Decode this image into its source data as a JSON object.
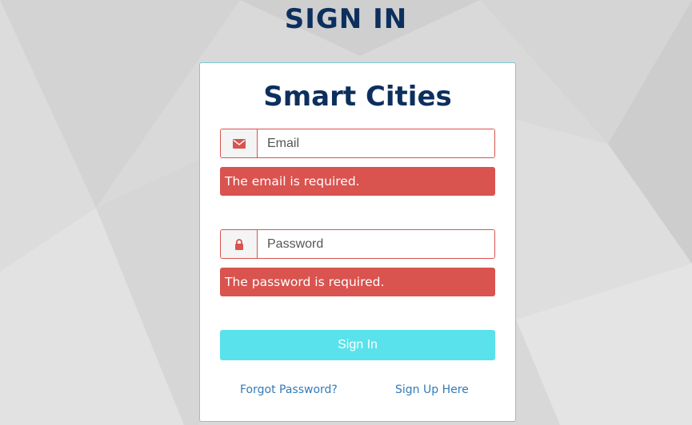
{
  "page": {
    "title": "SIGN IN"
  },
  "card": {
    "brand": "Smart Cities",
    "email": {
      "icon": "envelope-icon",
      "placeholder": "Email",
      "value": "",
      "error": "The email is required."
    },
    "password": {
      "icon": "lock-icon",
      "placeholder": "Password",
      "value": "",
      "error": "The password is required."
    },
    "submit_label": "Sign In",
    "forgot_label": "Forgot Password?",
    "signup_label": "Sign Up Here"
  },
  "colors": {
    "title": "#0d2f5e",
    "error": "#d9534f",
    "button": "#59e2eb",
    "link": "#337ab7"
  }
}
